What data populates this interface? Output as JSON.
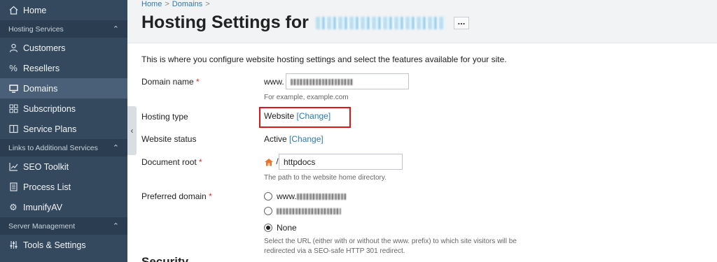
{
  "sidebar": {
    "items": [
      {
        "label": "Home",
        "icon": "home-icon"
      },
      {
        "section": "Hosting Services"
      },
      {
        "label": "Customers",
        "icon": "user-icon"
      },
      {
        "label": "Resellers",
        "icon": "percent-icon"
      },
      {
        "label": "Domains",
        "icon": "monitor-icon",
        "active": true
      },
      {
        "label": "Subscriptions",
        "icon": "grid-icon"
      },
      {
        "label": "Service Plans",
        "icon": "book-icon"
      },
      {
        "section": "Links to Additional Services"
      },
      {
        "label": "SEO Toolkit",
        "icon": "chart-icon"
      },
      {
        "label": "Process List",
        "icon": "list-icon"
      },
      {
        "label": "ImunifyAV",
        "icon": "gear-icon"
      },
      {
        "section": "Server Management"
      },
      {
        "label": "Tools & Settings",
        "icon": "sliders-icon"
      }
    ],
    "collapse_glyph": "‹"
  },
  "breadcrumb": {
    "home": "Home",
    "sep": ">",
    "domains": "Domains",
    "sep2": ">"
  },
  "page": {
    "title": "Hosting Settings for",
    "more": "...",
    "intro": "This is where you configure website hosting settings and select the features available for your site."
  },
  "form": {
    "domain_name_label": "Domain name",
    "required_mark": "*",
    "www_prefix": "www.",
    "domain_hint": "For example, example.com",
    "hosting_type_label": "Hosting type",
    "hosting_type_value": "Website",
    "change_link": "[Change]",
    "website_status_label": "Website status",
    "website_status_value": "Active",
    "document_root_label": "Document root",
    "doc_root_sep": "/",
    "doc_root_value": "httpdocs",
    "doc_root_hint": "The path to the website home directory.",
    "preferred_domain_label": "Preferred domain",
    "preferred_www_prefix": "www.",
    "none_option": "None",
    "preferred_hint_1": "Select the URL (either with or without the www. prefix) to which site visitors will be",
    "preferred_hint_2": "redirected via a SEO-safe HTTP 301 redirect.",
    "security_heading": "Security"
  },
  "colors": {
    "sidebar": "#35495e",
    "accent": "#2a7ab0",
    "highlight": "#e0151a"
  }
}
